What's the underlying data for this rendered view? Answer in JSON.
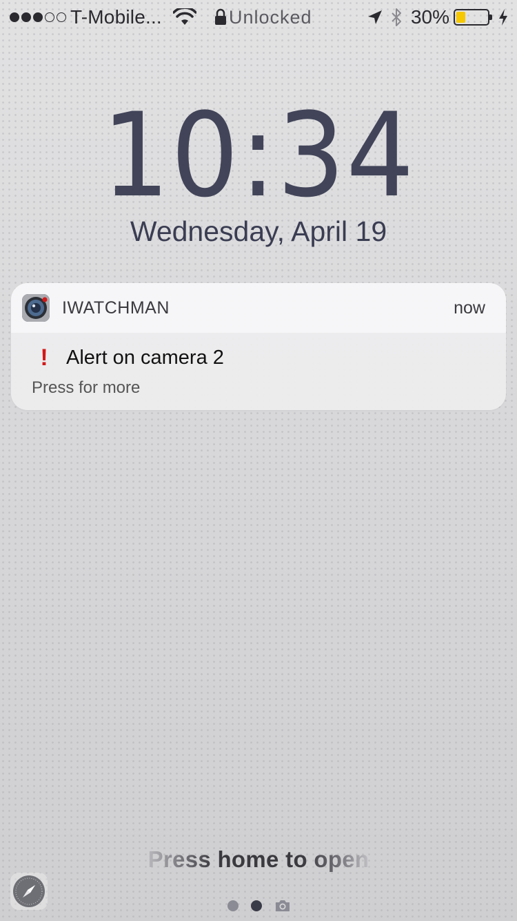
{
  "status_bar": {
    "carrier": "T-Mobile...",
    "signal_bars_filled": 3,
    "signal_bars_total": 5,
    "lock_status": "Unlocked",
    "battery_percent": "30%",
    "battery_level": 0.3,
    "battery_color": "#f5c800",
    "icons": [
      "wifi-icon",
      "lock-icon",
      "location-arrow-icon",
      "bluetooth-icon",
      "battery-icon",
      "charging-bolt-icon"
    ]
  },
  "lock_screen": {
    "time": "10:34",
    "date": "Wednesday, April 19",
    "unlock_hint": "Press home to open"
  },
  "notification": {
    "app_name": "IWATCHMAN",
    "time": "now",
    "title_icon": "!",
    "title": "Alert on camera 2",
    "subtitle": "Press for more",
    "accent_color": "#d21818"
  },
  "bottom": {
    "shortcut_icon": "compass-icon",
    "pages": 2,
    "active_page": 2,
    "camera_icon": "camera-icon"
  }
}
